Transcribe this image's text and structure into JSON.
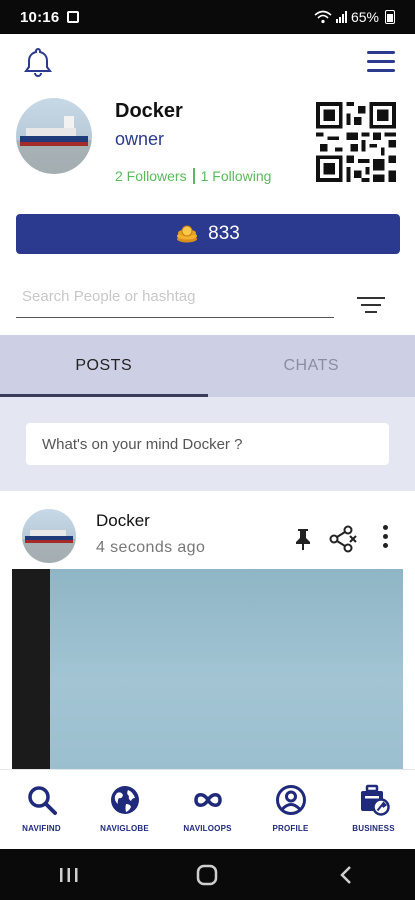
{
  "status_bar": {
    "time": "10:16",
    "battery": "65%"
  },
  "profile": {
    "name": "Docker",
    "role": "owner",
    "followers": "2 Followers",
    "following": "1 Following"
  },
  "coins": {
    "value": "833"
  },
  "search": {
    "placeholder": "Search People or hashtag"
  },
  "tabs": [
    {
      "label": "POSTS",
      "active": true
    },
    {
      "label": "CHATS",
      "active": false
    }
  ],
  "compose": {
    "placeholder": "What's on your mind Docker ?"
  },
  "post": {
    "author": "Docker",
    "time": "4 seconds ago"
  },
  "bottom_nav": [
    {
      "label": "NAVIFIND",
      "icon": "search-icon"
    },
    {
      "label": "NAVIGLOBE",
      "icon": "globe-icon"
    },
    {
      "label": "NAVILOOPS",
      "icon": "infinity-icon"
    },
    {
      "label": "PROFILE",
      "icon": "user-circle-icon"
    },
    {
      "label": "BUSINESS",
      "icon": "business-icon"
    }
  ],
  "colors": {
    "primary": "#2b3a8f",
    "tab_bg": "#cdd0e5",
    "compose_bg": "#e4e6f2",
    "accent_green": "#5cb85c"
  }
}
